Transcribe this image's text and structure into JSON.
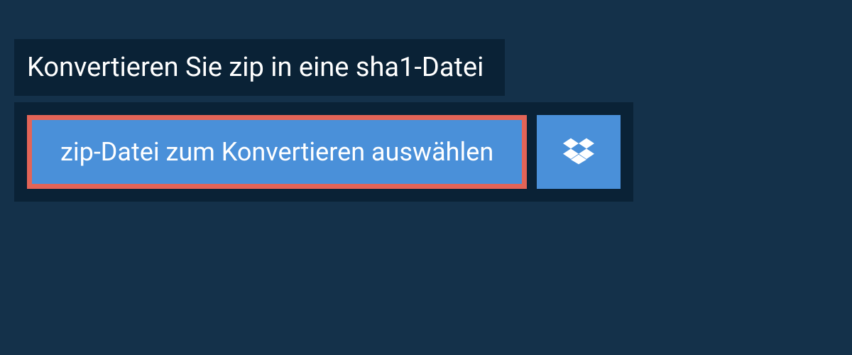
{
  "header": {
    "title": "Konvertieren Sie zip in eine sha1-Datei"
  },
  "actions": {
    "select_file_label": "zip-Datei zum Konvertieren auswählen"
  },
  "colors": {
    "page_background": "#14314a",
    "panel_background": "#0a2236",
    "button_background": "#4a90d9",
    "highlight_border": "#e36457",
    "text": "#ffffff"
  }
}
